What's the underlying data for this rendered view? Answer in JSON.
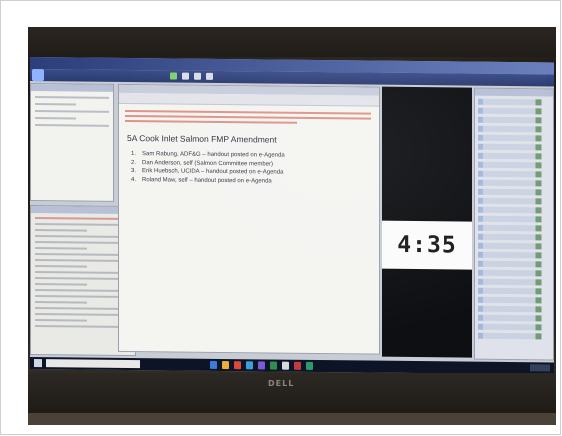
{
  "screen": {
    "timer": "4:35",
    "agenda": {
      "title": "5A Cook Inlet Salmon FMP Amendment",
      "items": [
        {
          "num": "1.",
          "text": "Sam Rabung, ADF&G – handout posted on e-Agenda"
        },
        {
          "num": "2.",
          "text": "Dan Anderson, self (Salmon Committee member)"
        },
        {
          "num": "3.",
          "text": "Erik Huebsch, UCIDA – handout posted on e-Agenda"
        },
        {
          "num": "4.",
          "text": "Roland Maw, self – handout posted on e-Agenda"
        }
      ]
    },
    "laptop_brand": "DELL"
  },
  "colors": {
    "titlebar": "#2d3f7a",
    "taskbar": "#0c1426",
    "timer_bg": "#fbfbfb",
    "video_bg": "#0e0f12"
  }
}
